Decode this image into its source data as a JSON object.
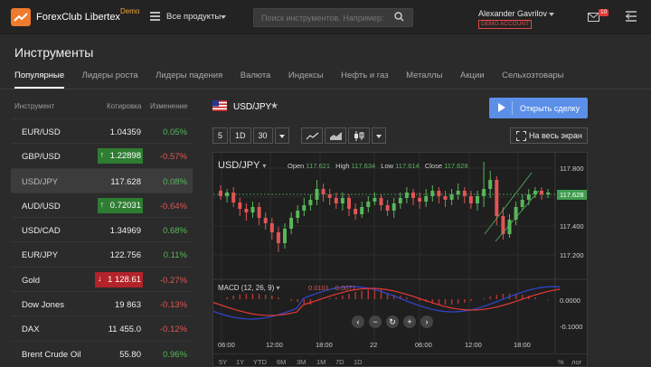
{
  "header": {
    "brand": "ForexClub Libertex",
    "brand_tag": "Demo",
    "products_label": "Все продукты",
    "search_placeholder": "Поиск инструментов. Например:",
    "user_name": "Alexander Gavrilov",
    "account_type": "DEMO ACCOUNT",
    "notifications_count": "10"
  },
  "page": {
    "title": "Инструменты",
    "tabs": [
      "Популярные",
      "Лидеры роста",
      "Лидеры падения",
      "Валюта",
      "Индексы",
      "Нефть и газ",
      "Металлы",
      "Акции",
      "Сельхозтовары"
    ]
  },
  "instruments": {
    "col_instrument": "Инструмент",
    "col_quote": "Котировка",
    "col_change": "Изменение",
    "rows": [
      {
        "name": "EUR/USD",
        "quote": "1.04359",
        "change": "0.05%",
        "dir": "pos",
        "flash": ""
      },
      {
        "name": "GBP/USD",
        "quote": "1.22898",
        "change": "-0.57%",
        "dir": "neg",
        "flash": "up"
      },
      {
        "name": "USD/JPY",
        "quote": "117.628",
        "change": "0.08%",
        "dir": "pos",
        "flash": ""
      },
      {
        "name": "AUD/USD",
        "quote": "0.72031",
        "change": "-0.64%",
        "dir": "neg",
        "flash": "up"
      },
      {
        "name": "USD/CAD",
        "quote": "1.34969",
        "change": "0.68%",
        "dir": "pos",
        "flash": ""
      },
      {
        "name": "EUR/JPY",
        "quote": "122.756",
        "change": "0.11%",
        "dir": "pos",
        "flash": ""
      },
      {
        "name": "Gold",
        "quote": "1 128.61",
        "change": "-0.27%",
        "dir": "neg",
        "flash": "down"
      },
      {
        "name": "Dow Jones",
        "quote": "19 863",
        "change": "-0.13%",
        "dir": "neg",
        "flash": ""
      },
      {
        "name": "DAX",
        "quote": "11 455.0",
        "change": "-0.12%",
        "dir": "neg",
        "flash": ""
      },
      {
        "name": "Brent Crude Oil",
        "quote": "55.80",
        "change": "0.96%",
        "dir": "pos",
        "flash": ""
      }
    ]
  },
  "chart_panel": {
    "pair": "USD/JPY",
    "open_trade_label": "Открыть сделку",
    "fullscreen_label": "На весь экран",
    "timeframes": [
      "5",
      "1D",
      "30"
    ],
    "chart_symbol": "USD/JPY",
    "ohlc": {
      "open_k": "Open",
      "open": "117.621",
      "high_k": "High",
      "high": "117.634",
      "low_k": "Low",
      "low": "117.614",
      "close_k": "Close",
      "close": "117.628"
    },
    "macd_label": "MACD (12, 26, 9)",
    "macd_v1": "0.0101",
    "macd_v2": "-0.0071",
    "price_ticks": [
      "117.800",
      "117.600",
      "117.400",
      "117.200"
    ],
    "current_price": "117.628",
    "macd_ticks": [
      "0.0000",
      "-0.1000"
    ],
    "time_ticks": [
      "06:00",
      "12:00",
      "18:00",
      "22",
      "06:00",
      "12:00",
      "18:00"
    ],
    "ranges": [
      "5Y",
      "1Y",
      "YTD",
      "6M",
      "3M",
      "1M",
      "7D",
      "1D"
    ],
    "scale_options": [
      "%",
      "лог"
    ],
    "colors": {
      "up": "#58b65a",
      "down": "#e05555",
      "accent": "#5b8fe8",
      "macd": "#2f47d6",
      "signal": "#e53935"
    }
  }
}
